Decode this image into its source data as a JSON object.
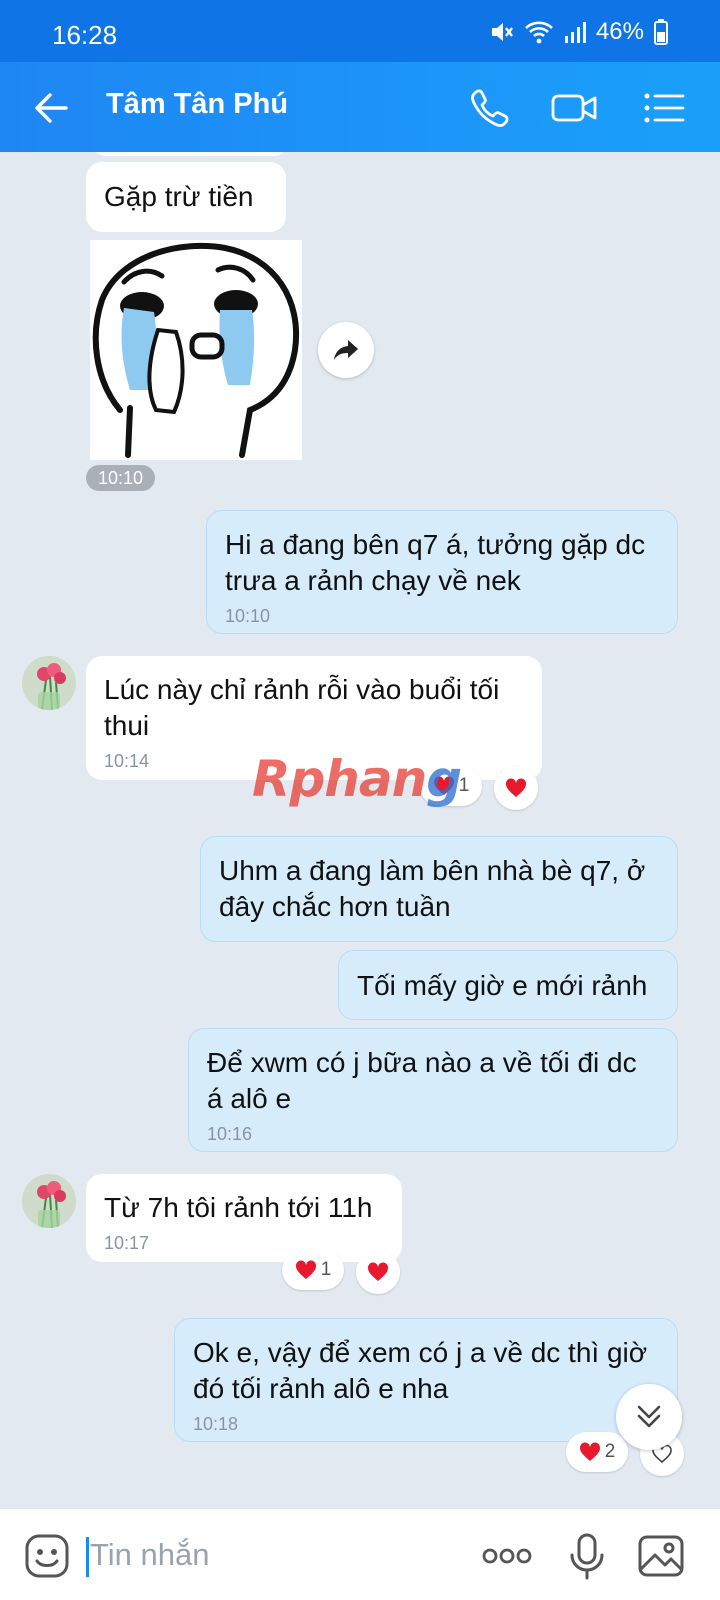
{
  "status_bar": {
    "time": "16:28",
    "battery": "46%"
  },
  "header": {
    "title": "Tâm Tân Phú"
  },
  "messages": [
    {
      "id": "m1",
      "from": "them",
      "text": "Gặp trừ tiền"
    },
    {
      "id": "m2",
      "from": "them",
      "type": "sticker",
      "time": "10:10"
    },
    {
      "id": "m3",
      "from": "me",
      "text": "Hi a đang bên q7 á, tưởng gặp dc trưa a rảnh chạy về nek",
      "time": "10:10"
    },
    {
      "id": "m4",
      "from": "them",
      "text": "Lúc này chỉ rảnh rỗi vào buổi tối thui",
      "time": "10:14",
      "reaction_count": "1"
    },
    {
      "id": "m5",
      "from": "me",
      "text": "Uhm a đang làm bên nhà bè q7, ở đây chắc hơn tuần"
    },
    {
      "id": "m6",
      "from": "me",
      "text": "Tối mấy giờ e mới rảnh"
    },
    {
      "id": "m7",
      "from": "me",
      "text": "Để xwm có j bữa nào a về tối đi dc á alô e",
      "time": "10:16"
    },
    {
      "id": "m8",
      "from": "them",
      "text": "Từ 7h tôi rảnh tới 11h",
      "time": "10:17",
      "reaction_count": "1"
    },
    {
      "id": "m9",
      "from": "me",
      "text": "Ok e, vậy để xem có j a về dc thì giờ đó tối rảnh alô e nha",
      "time": "10:18",
      "reaction_count": "2"
    }
  ],
  "watermark": {
    "part1": "Rphan",
    "part2": "g"
  },
  "input": {
    "placeholder": "Tin nhắn"
  },
  "colors": {
    "accent": "#1a8cf1",
    "outgoing_bubble": "#d6ecfb",
    "heart": "#e8192c"
  }
}
